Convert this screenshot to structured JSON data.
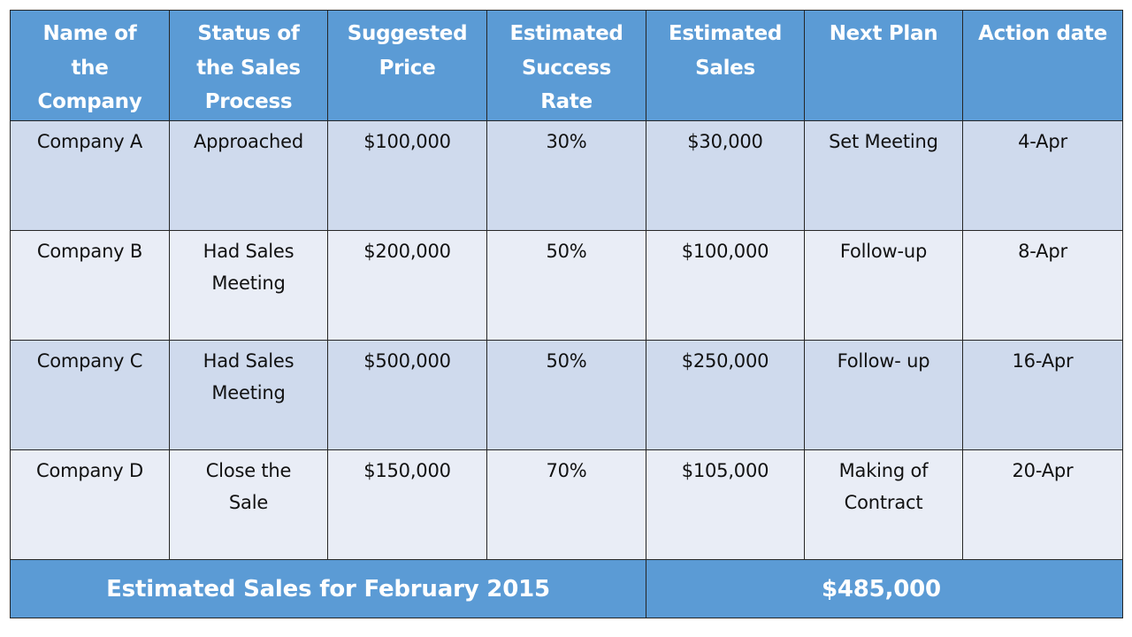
{
  "table": {
    "headers": [
      [
        "Name of",
        "the",
        "Company"
      ],
      [
        "Status of",
        "the Sales",
        "Process"
      ],
      [
        "Suggested",
        "Price"
      ],
      [
        "Estimated",
        "Success",
        "Rate"
      ],
      [
        "Estimated",
        "Sales"
      ],
      [
        "Next Plan"
      ],
      [
        "Action date"
      ]
    ],
    "rows": [
      {
        "company": [
          "Company  A"
        ],
        "status": [
          "Approached"
        ],
        "suggested_price": [
          "$100,000"
        ],
        "success_rate": [
          "30%"
        ],
        "estimated_sales": [
          "$30,000"
        ],
        "next_plan": [
          "Set Meeting"
        ],
        "action_date": [
          "4-Apr"
        ]
      },
      {
        "company": [
          "Company  B"
        ],
        "status": [
          "Had Sales",
          "Meeting"
        ],
        "suggested_price": [
          "$200,000"
        ],
        "success_rate": [
          "50%"
        ],
        "estimated_sales": [
          "$100,000"
        ],
        "next_plan": [
          "Follow-up"
        ],
        "action_date": [
          "8-Apr"
        ]
      },
      {
        "company": [
          "Company  C"
        ],
        "status": [
          "Had Sales",
          "Meeting"
        ],
        "suggested_price": [
          "$500,000"
        ],
        "success_rate": [
          "50%"
        ],
        "estimated_sales": [
          "$250,000"
        ],
        "next_plan": [
          "Follow- up"
        ],
        "action_date": [
          "16-Apr"
        ]
      },
      {
        "company": [
          "Company  D"
        ],
        "status": [
          "Close the",
          "Sale"
        ],
        "suggested_price": [
          "$150,000"
        ],
        "success_rate": [
          "70%"
        ],
        "estimated_sales": [
          "$105,000"
        ],
        "next_plan": [
          "Making of",
          "Contract"
        ],
        "action_date": [
          "20-Apr"
        ]
      }
    ],
    "footer": {
      "label": "Estimated Sales for February 2015",
      "total": "$485,000"
    }
  },
  "colors": {
    "header_bg": "#5b9bd5",
    "header_text": "#ffffff",
    "row_odd_bg": "#cfdaed",
    "row_even_bg": "#e9edf6",
    "border": "#262626"
  }
}
